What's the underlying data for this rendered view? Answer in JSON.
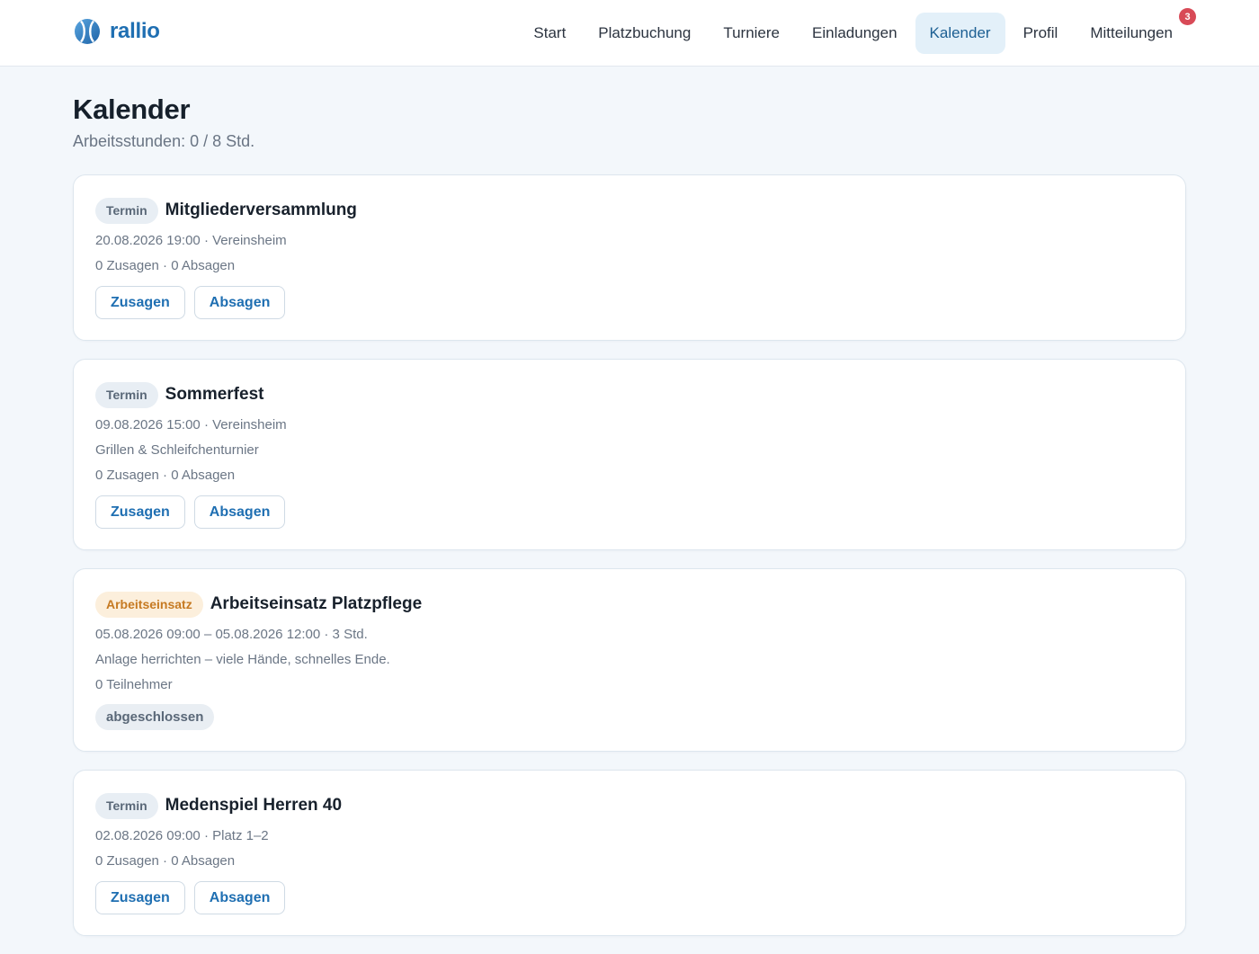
{
  "brand": {
    "name": "rallio",
    "logo_icon": "tennis-ball-icon"
  },
  "nav": {
    "items": [
      {
        "label": "Start"
      },
      {
        "label": "Platzbuchung"
      },
      {
        "label": "Turniere"
      },
      {
        "label": "Einladungen"
      },
      {
        "label": "Kalender",
        "active": true
      },
      {
        "label": "Profil"
      },
      {
        "label": "Mitteilungen",
        "badge": "3"
      }
    ]
  },
  "page": {
    "title": "Kalender",
    "subtitle": "Arbeitsstunden: 0 / 8 Std."
  },
  "events": [
    {
      "tag": "Termin",
      "title": "Mitgliederversammlung",
      "when_where": "20.08.2026 19:00 · Vereinsheim",
      "responses": "0 Zusagen · 0 Absagen",
      "accept_label": "Zusagen",
      "decline_label": "Absagen"
    },
    {
      "tag": "Termin",
      "title": "Sommerfest",
      "when_where": "09.08.2026 15:00 · Vereinsheim",
      "description": "Grillen & Schleifchenturnier",
      "responses": "0 Zusagen · 0 Absagen",
      "accept_label": "Zusagen",
      "decline_label": "Absagen"
    },
    {
      "tag": "Arbeitseinsatz",
      "title": "Arbeitseinsatz Platzpflege",
      "when_where": "05.08.2026 09:00 – 05.08.2026 12:00 · 3 Std.",
      "description": "Anlage herrichten – viele Hände, schnelles Ende.",
      "participants": "0 Teilnehmer",
      "status": "abgeschlossen"
    },
    {
      "tag": "Termin",
      "title": "Medenspiel Herren 40",
      "when_where": "02.08.2026 09:00 · Platz 1–2",
      "responses": "0 Zusagen · 0 Absagen",
      "accept_label": "Zusagen",
      "decline_label": "Absagen"
    }
  ],
  "colors": {
    "accent": "#1f6fb2",
    "background": "#f3f7fb",
    "nav_active_bg": "#e3f0f9",
    "badge": "#d84a57",
    "tag_arbeit_text": "#c67a22",
    "tag_arbeit_bg": "#fcefdc"
  }
}
